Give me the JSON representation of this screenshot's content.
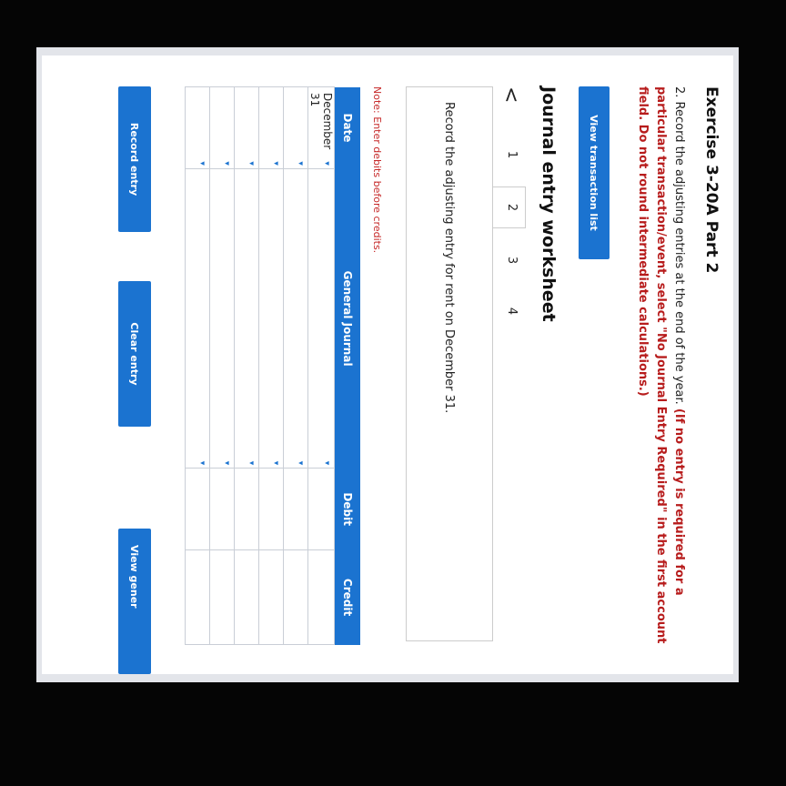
{
  "exercise_title": "Exercise 3-20A Part 2",
  "instructions": {
    "plain": "2. Record the adjusting entries at the end of the year.",
    "bold": "(If no entry is required for a particular transaction/event, select \"No Journal Entry Required\" in the first account field. Do not round intermediate calculations.)"
  },
  "view_transaction_label": "View transaction list",
  "worksheet_title": "Journal entry worksheet",
  "nav": {
    "prev": "<",
    "steps": [
      "1",
      "2",
      "3",
      "4"
    ],
    "active_step": "2"
  },
  "entry_description": "Record the adjusting entry for rent on December 31.",
  "note": "Note: Enter debits before credits.",
  "table": {
    "headers": [
      "Date",
      "General Journal",
      "Debit",
      "Credit"
    ],
    "rows": [
      [
        "December 31",
        "",
        "",
        ""
      ],
      [
        "",
        "",
        "",
        ""
      ],
      [
        "",
        "",
        "",
        ""
      ],
      [
        "",
        "",
        "",
        ""
      ],
      [
        "",
        "",
        "",
        ""
      ],
      [
        "",
        "",
        "",
        ""
      ]
    ]
  },
  "buttons": {
    "record": "Record entry",
    "clear": "Clear entry",
    "view_general": "View gener"
  }
}
